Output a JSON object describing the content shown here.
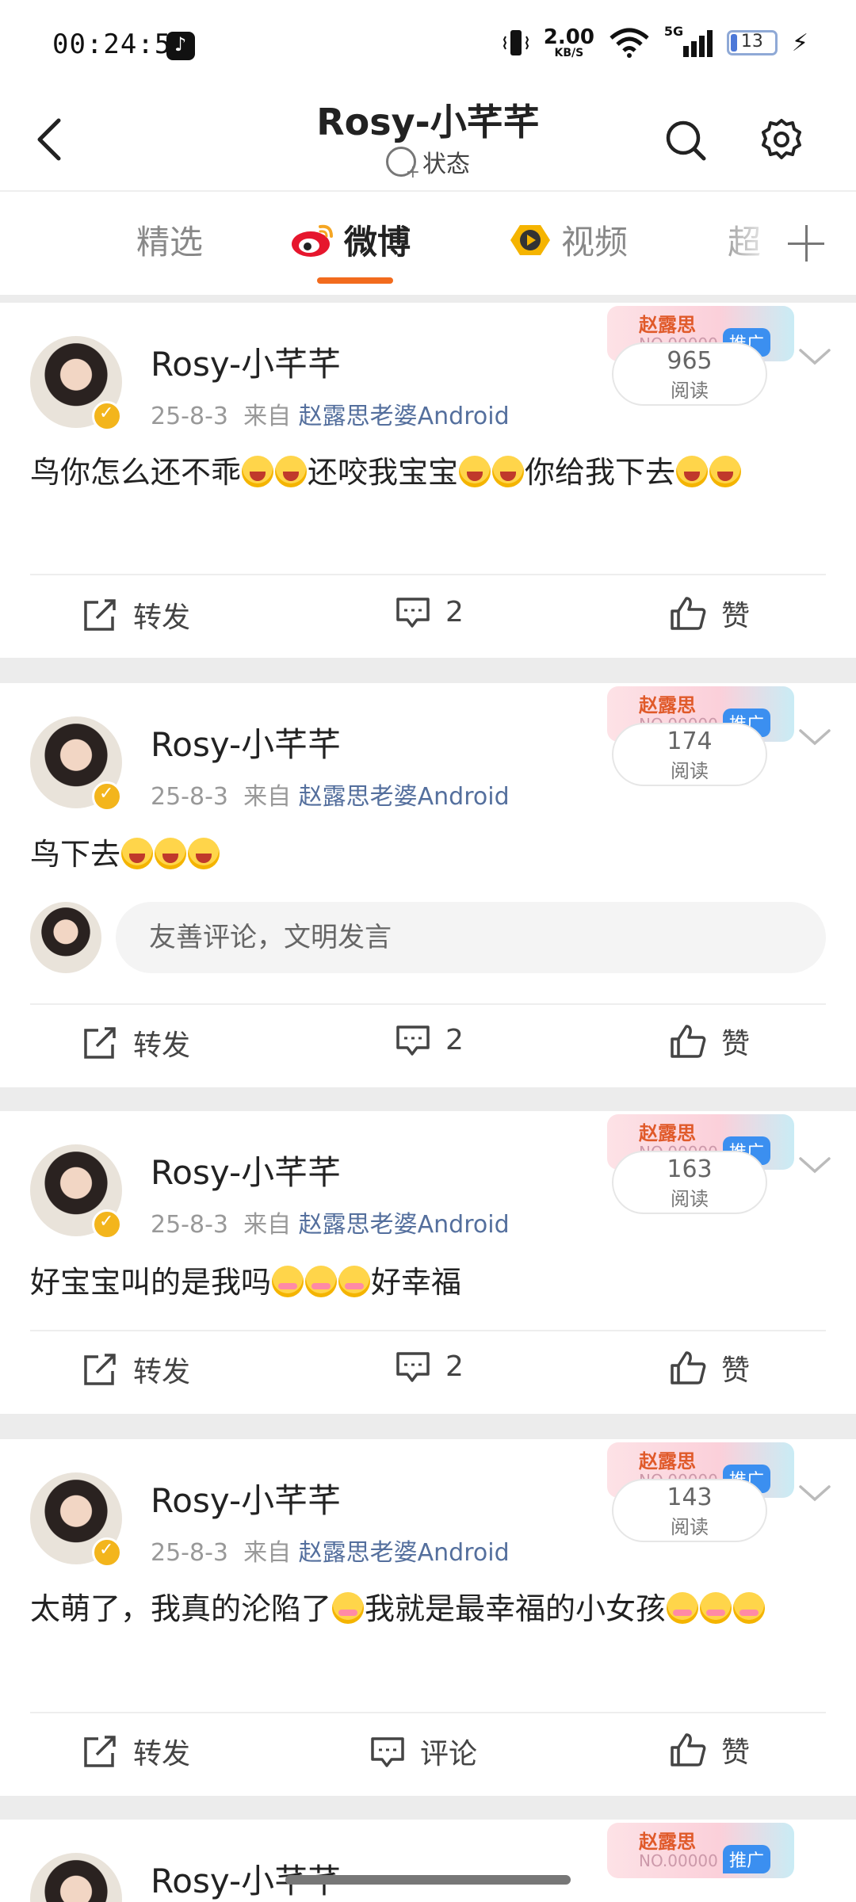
{
  "status_bar": {
    "time": "00:24:55",
    "net_speed_value": "2.00",
    "net_speed_unit": "KB/S",
    "network": "5G",
    "battery": "13",
    "icons": [
      "tiktok-icon",
      "vibrate-icon",
      "wifi-icon",
      "signal-icon",
      "battery-icon",
      "charging-icon"
    ]
  },
  "header": {
    "title": "Rosy-小芊芊",
    "status_label": "状态"
  },
  "tabs": [
    {
      "label": "精选",
      "active": false
    },
    {
      "label": "微博",
      "active": true
    },
    {
      "label": "视频",
      "active": false
    },
    {
      "label": "超",
      "active": false
    }
  ],
  "accent_color": "#f26b1d",
  "posts": [
    {
      "author": "Rosy-小芊芊",
      "date": "25-8-3",
      "from_label": "来自",
      "source": "赵露思老婆Android",
      "reads": "965",
      "reads_label": "阅读",
      "promo_name": "赵露思",
      "promo_code": "NO.00000",
      "promo_tag": "推广",
      "text_a": "鸟你怎么还不乖",
      "text_b": "还咬我宝宝",
      "text_c": "你给我下去",
      "repost": "转发",
      "comments": "2",
      "like": "赞"
    },
    {
      "author": "Rosy-小芊芊",
      "date": "25-8-3",
      "from_label": "来自",
      "source": "赵露思老婆Android",
      "reads": "174",
      "reads_label": "阅读",
      "promo_name": "赵露思",
      "promo_code": "NO.00000",
      "promo_tag": "推广",
      "text_a": "鸟下去",
      "comment_placeholder": "友善评论，文明发言",
      "repost": "转发",
      "comments": "2",
      "like": "赞"
    },
    {
      "author": "Rosy-小芊芊",
      "date": "25-8-3",
      "from_label": "来自",
      "source": "赵露思老婆Android",
      "reads": "163",
      "reads_label": "阅读",
      "promo_name": "赵露思",
      "promo_code": "NO.00000",
      "promo_tag": "推广",
      "text_a": "好宝宝叫的是我吗",
      "text_b": "好幸福",
      "repost": "转发",
      "comments": "2",
      "like": "赞"
    },
    {
      "author": "Rosy-小芊芊",
      "date": "25-8-3",
      "from_label": "来自",
      "source": "赵露思老婆Android",
      "reads": "143",
      "reads_label": "阅读",
      "promo_name": "赵露思",
      "promo_code": "NO.00000",
      "promo_tag": "推广",
      "text_a": "太萌了，我真的沦陷了",
      "text_b": "我就是最幸福的小女孩",
      "repost": "转发",
      "comments": "评论",
      "like": "赞"
    },
    {
      "author": "Rosy-小芊芊",
      "promo_name": "赵露思",
      "promo_code": "NO.00000",
      "promo_tag": "推广"
    }
  ]
}
